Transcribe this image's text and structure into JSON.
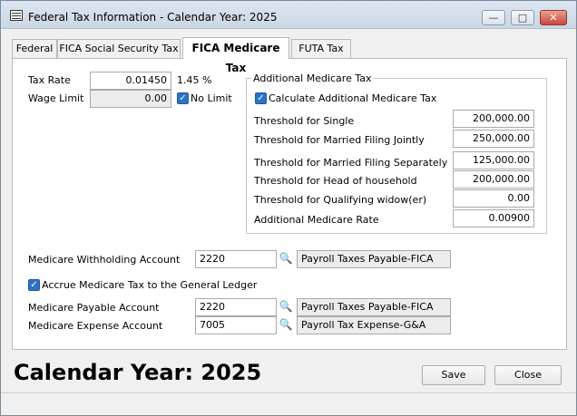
{
  "window": {
    "title": "Federal Tax Information - Calendar Year: 2025",
    "minimize_glyph": "—",
    "maximize_glyph": "□",
    "close_glyph": "✕"
  },
  "tabs": [
    {
      "label": "Federal"
    },
    {
      "label": "FICA Social Security Tax"
    },
    {
      "label": "FICA Medicare Tax"
    },
    {
      "label": "FUTA Tax"
    }
  ],
  "tax": {
    "rate_label": "Tax Rate",
    "rate_value": "0.01450",
    "rate_percent": "1.45 %",
    "wage_limit_label": "Wage Limit",
    "wage_limit_value": "0.00",
    "no_limit_label": "No Limit"
  },
  "additional": {
    "legend": "Additional Medicare Tax",
    "calculate_label": "Calculate Additional Medicare Tax",
    "rows": [
      {
        "label": "Threshold for Single",
        "value": "200,000.00"
      },
      {
        "label": "Threshold for Married Filing Jointly",
        "value": "250,000.00"
      },
      {
        "label": "Threshold for Married Filing Separately",
        "value": "125,000.00"
      },
      {
        "label": "Threshold for Head of household",
        "value": "200,000.00"
      },
      {
        "label": "Threshold for Qualifying widow(er)",
        "value": "0.00"
      },
      {
        "label": "Additional Medicare Rate",
        "value": "0.00900"
      }
    ]
  },
  "accounts": {
    "withholding_label": "Medicare Withholding Account",
    "withholding_code": "2220",
    "withholding_desc": "Payroll Taxes Payable-FICA",
    "accrue_label": "Accrue Medicare Tax to the General Ledger",
    "payable_label": "Medicare Payable Account",
    "payable_code": "2220",
    "payable_desc": "Payroll Taxes Payable-FICA",
    "expense_label": "Medicare Expense Account",
    "expense_code": "7005",
    "expense_desc": "Payroll Tax Expense-G&A"
  },
  "footer": {
    "calendar_title": "Calendar Year: 2025",
    "save_label": "Save",
    "close_label": "Close"
  },
  "icons": {
    "lookup": "🔍",
    "check": "✓"
  }
}
